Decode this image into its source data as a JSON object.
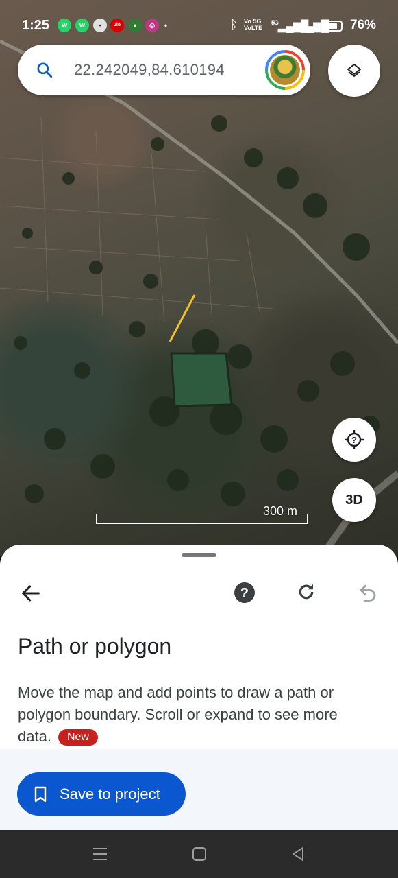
{
  "status_bar": {
    "time": "1:25",
    "volte_top": "Vo 5G",
    "volte_bottom": "VoLTE",
    "signal": "5G",
    "battery": "76%"
  },
  "search": {
    "query": "22.242049,84.610194"
  },
  "map": {
    "scale_label": "300 m",
    "btn_3d": "3D",
    "colors": {
      "path_line": "#f2c12e"
    }
  },
  "sheet": {
    "title": "Path or polygon",
    "description": "Move the map and add points to draw a path or polygon boundary. Scroll or expand to see more data.",
    "badge": "New",
    "save_button": "Save to project"
  },
  "colors": {
    "accent": "#0b57d0",
    "badge": "#c5221f"
  }
}
